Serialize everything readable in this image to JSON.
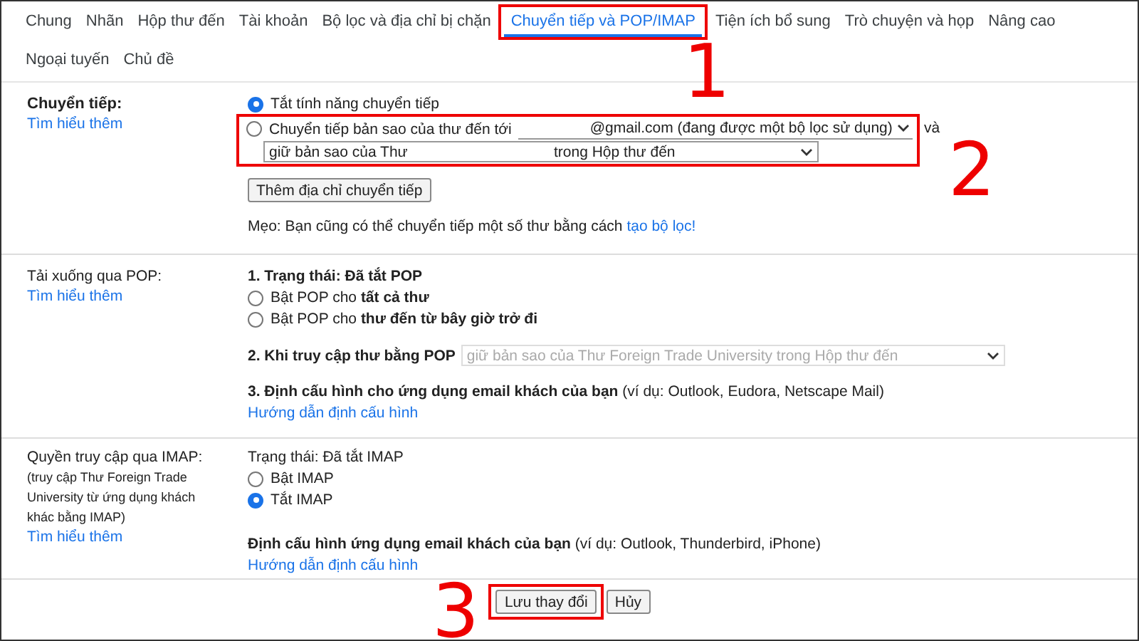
{
  "tabs": [
    {
      "label": "Chung",
      "selected": false
    },
    {
      "label": "Nhãn",
      "selected": false
    },
    {
      "label": "Hộp thư đến",
      "selected": false
    },
    {
      "label": "Tài khoản",
      "selected": false
    },
    {
      "label": "Bộ lọc và địa chỉ bị chặn",
      "selected": false
    },
    {
      "label": "Chuyển tiếp và POP/IMAP",
      "selected": true
    },
    {
      "label": "Tiện ích bổ sung",
      "selected": false
    },
    {
      "label": "Trò chuyện và họp",
      "selected": false
    },
    {
      "label": "Nâng cao",
      "selected": false
    },
    {
      "label": "Ngoại tuyến",
      "selected": false
    },
    {
      "label": "Chủ đề",
      "selected": false
    }
  ],
  "forwarding": {
    "title": "Chuyển tiếp:",
    "learn_more": "Tìm hiểu thêm",
    "options": [
      {
        "label": "Tắt tính năng chuyển tiếp",
        "selected": true
      },
      {
        "label": "Chuyển tiếp bản sao của thư đến tới",
        "selected": false
      }
    ],
    "address_select": "@gmail.com (đang được một bộ lọc sử dụng)",
    "and": "và",
    "keep_select": [
      "giữ bản sao của Thư",
      "trong Hộp thư đến"
    ],
    "add_button": "Thêm địa chỉ chuyển tiếp",
    "tip": "Mẹo: Bạn cũng có thể chuyển tiếp một số thư bằng cách",
    "tip_link": "tạo bộ lọc!"
  },
  "pop": {
    "title": "Tải xuống qua POP:",
    "learn_more": "Tìm hiểu thêm",
    "status": "1. Trạng thái: Đã tắt POP",
    "options": [
      {
        "label": "Bật POP cho **tất cả thư**",
        "selected": false
      },
      {
        "label": "Bật POP cho **thư đến từ bây giờ trở đi**",
        "selected": false
      }
    ],
    "access_label": "2. Khi truy cập thư bằng POP",
    "access_select": "giữ bản sao của Thư Foreign Trade University trong Hộp thư đến",
    "access_disabled": true,
    "config": "**3. Định cấu hình cho ứng dụng email khách của bạn** (ví dụ: Outlook, Eudora, Netscape Mail)",
    "config_link": "Hướng dẫn định cấu hình"
  },
  "imap": {
    "title": "Quyền truy cập qua IMAP:",
    "note": "(truy cập Thư Foreign Trade University từ ứng dụng khách khác bằng IMAP)",
    "learn_more": "Tìm hiểu thêm",
    "status": "Trạng thái: Đã tắt IMAP",
    "options": [
      {
        "label": "Bật IMAP",
        "selected": false
      },
      {
        "label": "Tắt IMAP",
        "selected": true
      }
    ],
    "config": "**Định cấu hình ứng dụng email khách của bạn** (ví dụ: Outlook, Thunderbird, iPhone)",
    "config_link": "Hướng dẫn định cấu hình"
  },
  "buttons": [
    {
      "label": "Lưu thay đổi",
      "kind": "primary"
    },
    {
      "label": "Hủy",
      "kind": "plain"
    }
  ],
  "annotations": [
    "1",
    "2",
    "3"
  ]
}
